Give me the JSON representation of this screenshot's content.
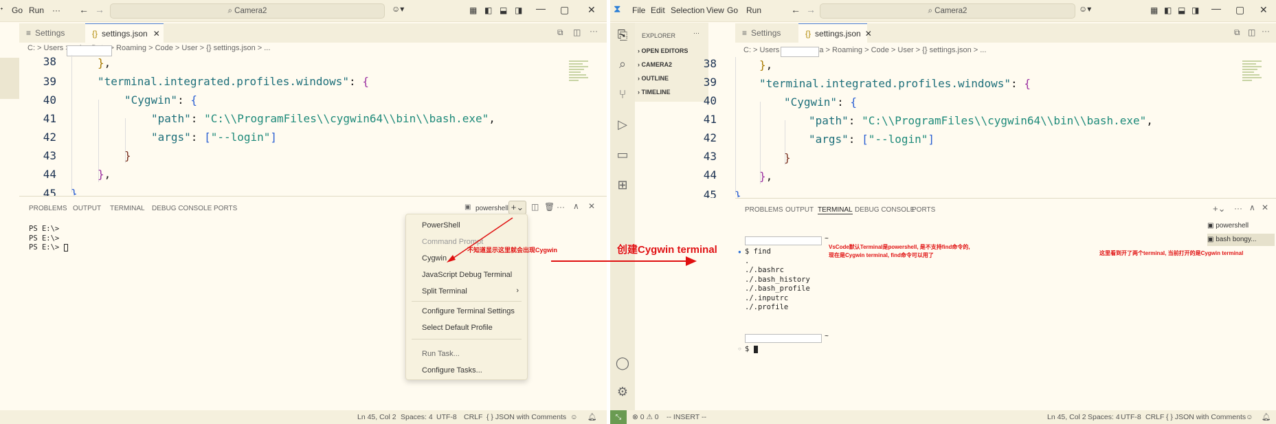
{
  "left": {
    "titlebar": {
      "menus": [
        "Go",
        "Run",
        "···"
      ],
      "search": "Camera2",
      "win": [
        "—",
        "▢",
        "✕"
      ]
    },
    "tabs": [
      {
        "label": "Settings",
        "icon": "≡"
      },
      {
        "label": "settings.json",
        "icon": "{}",
        "close": "✕"
      }
    ],
    "breadcrumb": "C: > Users >             > AppData > Roaming > Code > User > {} settings.json > ...",
    "panel_tabs": [
      "PROBLEMS",
      "OUTPUT",
      "TERMINAL",
      "DEBUG CONSOLE",
      "PORTS"
    ],
    "shell_label": "powershell",
    "terminal_lines": [
      "PS E:\\>",
      "PS E:\\>",
      "PS E:\\>"
    ],
    "menu": {
      "group1": [
        "PowerShell",
        "Command Prompt",
        "Cygwin",
        "JavaScript Debug Terminal",
        "Split Terminal"
      ],
      "group2": [
        "Configure Terminal Settings",
        "Select Default Profile"
      ],
      "group3": [
        "Run Task...",
        "Configure Tasks..."
      ],
      "chevron": "›"
    },
    "annotation": "不知道显示这里就会出现Cygwin",
    "status": {
      "ln": "Ln 45, Col 2",
      "spaces": "Spaces: 4",
      "enc": "UTF-8",
      "eol": "CRLF",
      "lang": "{ } JSON with Comments"
    }
  },
  "right": {
    "titlebar": {
      "menus": [
        "File",
        "Edit",
        "Selection",
        "View",
        "Go",
        "Run"
      ],
      "search": "Camera2",
      "win": [
        "—",
        "▢",
        "✕"
      ]
    },
    "explorer": {
      "title": "EXPLORER",
      "sections": [
        "OPEN EDITORS",
        "CAMERA2",
        "OUTLINE",
        "TIMELINE"
      ]
    },
    "tabs": [
      {
        "label": "Settings",
        "icon": "≡"
      },
      {
        "label": "settings.json",
        "icon": "{}",
        "close": "✕"
      }
    ],
    "breadcrumb": "C: > Users >             > AppData > Roaming > Code > User > {} settings.json > ...",
    "panel_tabs": [
      "PROBLEMS",
      "OUTPUT",
      "TERMINAL",
      "DEBUG CONSOLE",
      "PORTS"
    ],
    "terminal_lines": [
      "$ find",
      ".",
      "./.bashrc",
      "./.bash_history",
      "./.bash_profile",
      "./.inputrc",
      "./.profile"
    ],
    "prompt": "$",
    "terminal_list": [
      "powershell",
      "bash  bongy..."
    ],
    "annotation1": "VsCode默认Terminal是powershell, 是不支持find命令的,",
    "annotation1b": "现在是Cygwin terminal, find命令可以用了",
    "annotation2": "这里看到开了两个terminal, 当前打开的是Cygwin terminal",
    "status": {
      "left": "⊗ 0 ⚠ 0",
      "mode": "-- INSERT --",
      "ln": "Ln 45, Col 2",
      "spaces": "Spaces: 4",
      "enc": "UTF-8",
      "eol": "CRLF",
      "lang": "{ } JSON with Comments"
    }
  },
  "editor": {
    "line_numbers": [
      "38",
      "39",
      "40",
      "41",
      "42",
      "43",
      "44",
      "45"
    ],
    "line39_key": "\"terminal.integrated.profiles.windows\"",
    "line40_key": "\"Cygwin\"",
    "line41_key": "\"path\"",
    "line41_val": "\"C:\\\\ProgramFiles\\\\cygwin64\\\\bin\\\\bash.exe\"",
    "line42_key": "\"args\"",
    "line42_val": "\"--login\""
  },
  "center_annotation": "创建Cygwin terminal",
  "colors": {
    "annotation": "#e01010",
    "bg": "#fffbf0",
    "accent": "#4a7cd0"
  }
}
